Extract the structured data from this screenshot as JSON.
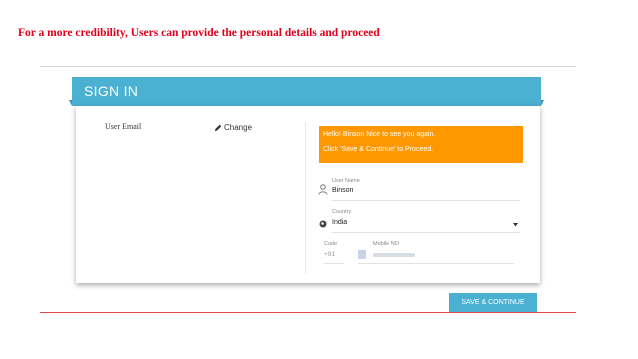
{
  "caption": "For a more credibility, Users can provide the personal details and proceed",
  "signin": {
    "title": "SIGN IN",
    "user_email_label": "User Email",
    "change_label": "Change",
    "alert": {
      "line1": "Hello! Binson Nice to see you again.",
      "line2": "Click 'Save & Continue' to Proceed."
    },
    "user_name": {
      "label": "User Name",
      "value": "Binson"
    },
    "country": {
      "label": "Country",
      "value": "India"
    },
    "code": {
      "label": "Code",
      "value": "+91"
    },
    "mobile": {
      "label": "Mobile NO",
      "value": ""
    },
    "save_button": "SAVE & CONTINUE"
  },
  "icons": [
    "pencil-icon",
    "person-icon",
    "globe-icon",
    "caret-down-icon"
  ],
  "colors": {
    "header": "#4ab1d2",
    "alert": "#ff9800",
    "caption": "#e0001b",
    "button": "#4ab1d2"
  }
}
